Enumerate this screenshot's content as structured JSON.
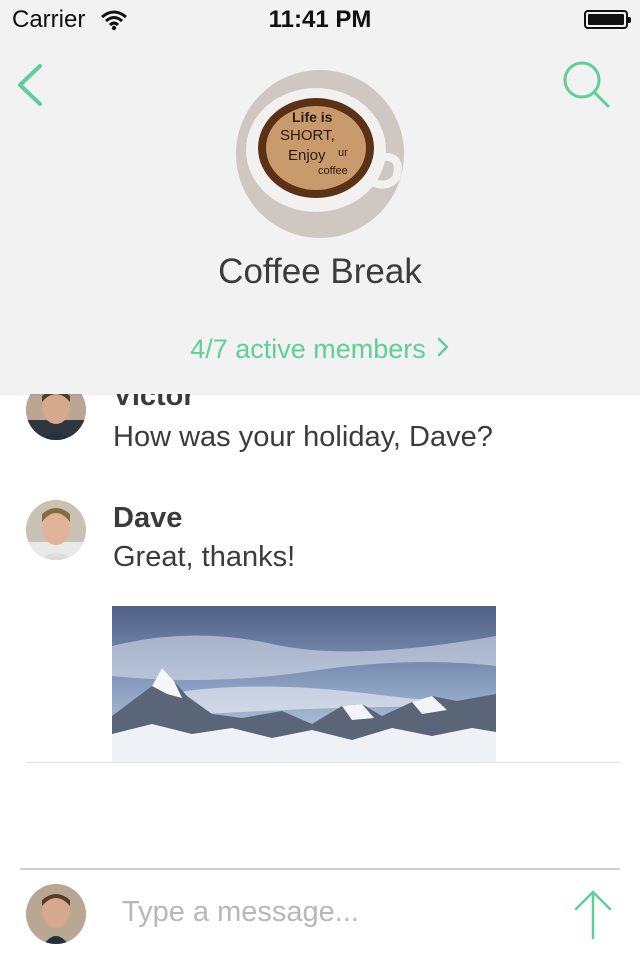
{
  "status_bar": {
    "carrier": "Carrier",
    "time": "11:41 PM"
  },
  "header": {
    "group_name": "Coffee Break",
    "members_link": "4/7 active members",
    "cup_text": [
      "Life is",
      "SHORT,",
      "Enjoy",
      "ur",
      "coffee"
    ]
  },
  "messages": [
    {
      "author": "Victor",
      "text": "How was your holiday, Dave?"
    },
    {
      "author": "Dave",
      "text": "Great, thanks!"
    }
  ],
  "composer": {
    "placeholder": "Type a message..."
  },
  "colors": {
    "accent": "#5fcf97",
    "header_bg": "#f2f2f2",
    "text": "#3b3b3b"
  },
  "icons": [
    "back-chevron-icon",
    "search-icon",
    "send-arrow-icon",
    "wifi-icon",
    "battery-icon"
  ]
}
